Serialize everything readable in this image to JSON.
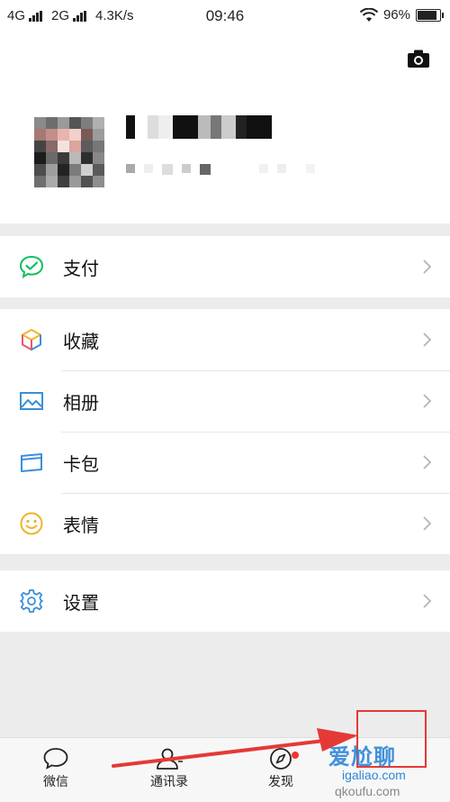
{
  "status_bar": {
    "network1": "4G",
    "network2": "2G",
    "speed": "4.3K/s",
    "time": "09:46",
    "battery": "96%",
    "battery_level": 0.96
  },
  "menu": {
    "pay": {
      "label": "支付",
      "icon": "wechat-pay-icon",
      "color": "#07c160"
    },
    "favorites": {
      "label": "收藏",
      "icon": "cube-icon"
    },
    "album": {
      "label": "相册",
      "icon": "picture-icon",
      "color": "#3a8fd8"
    },
    "cards": {
      "label": "卡包",
      "icon": "card-icon",
      "color": "#3a8fd8"
    },
    "stickers": {
      "label": "表情",
      "icon": "smile-icon",
      "color": "#f0b429"
    },
    "settings": {
      "label": "设置",
      "icon": "gear-icon",
      "color": "#3a8fd8"
    }
  },
  "tabs": {
    "chats": "微信",
    "contacts": "通讯录",
    "discover": "发现"
  },
  "watermark": {
    "main": "爱尬聊",
    "url": "igaliao.com",
    "sub": "qkoufu.com"
  },
  "annotation": {
    "color": "#e53935"
  }
}
